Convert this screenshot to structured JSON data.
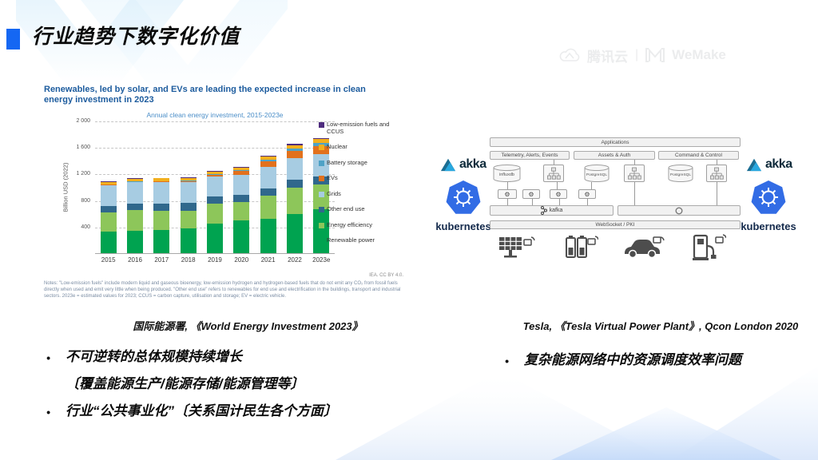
{
  "slide": {
    "title": "行业趋势下数字化价值"
  },
  "brand": {
    "tencent_cloud": "腾讯云",
    "divider": "|",
    "wemake": "WeMake"
  },
  "chart_panel": {
    "headline": "Renewables, led by solar, and EVs are leading the expected increase in clean energy investment in 2023",
    "source_note": "IEA. CC BY 4.0.",
    "notes": "Notes: \"Low-emission fuels\" include modern liquid and gaseous bioenergy, low-emission hydrogen and hydrogen-based fuels that do not emit any CO₂ from fossil fuels directly when used and emit very little when being produced. \"Other end use\" refers to renewables for end use and electrification in the buildings, transport and industrial sectors. 2023e = estimated values for 2023; CCUS = carbon capture, utilisation and storage; EV = electric vehicle.",
    "caption": "国际能源署, 《World Energy Investment 2023》"
  },
  "chart_data": {
    "type": "bar",
    "stacked": true,
    "title": "Annual clean energy investment, 2015-2023e",
    "xlabel": "",
    "ylabel": "Billion USD (2022)",
    "ylim": [
      0,
      2000
    ],
    "ytick_values": [
      400,
      800,
      1200,
      1600,
      2000
    ],
    "ytick_labels": [
      "400",
      "800",
      "1 200",
      "1 600",
      "2 000"
    ],
    "grid": true,
    "legend_position": "right",
    "categories": [
      "2015",
      "2016",
      "2017",
      "2018",
      "2019",
      "2020",
      "2021",
      "2022",
      "2023e"
    ],
    "series": [
      {
        "name": "Renewable power",
        "color": "#00A350",
        "values": [
          330,
          340,
          350,
          375,
          450,
          490,
          515,
          595,
          660
        ]
      },
      {
        "name": "Energy efficiency",
        "color": "#8DC65A",
        "values": [
          280,
          305,
          290,
          265,
          295,
          285,
          355,
          395,
          380
        ]
      },
      {
        "name": "Other end use",
        "color": "#30688C",
        "values": [
          100,
          105,
          105,
          115,
          110,
          105,
          105,
          115,
          120
        ]
      },
      {
        "name": "Grids",
        "color": "#A7CCE2",
        "values": [
          320,
          320,
          330,
          315,
          300,
          305,
          325,
          325,
          330
        ]
      },
      {
        "name": "EVs",
        "color": "#E2711D",
        "values": [
          5,
          8,
          12,
          18,
          32,
          55,
          85,
          115,
          130
        ]
      },
      {
        "name": "Battery storage",
        "color": "#4EA2C6",
        "values": [
          2,
          2,
          3,
          4,
          6,
          10,
          20,
          35,
          40
        ]
      },
      {
        "name": "Nuclear",
        "color": "#F2B01E",
        "values": [
          35,
          40,
          40,
          40,
          42,
          45,
          48,
          52,
          62
        ]
      },
      {
        "name": "Low-emission fuels and CCUS",
        "color": "#4F2D7F",
        "values": [
          8,
          8,
          8,
          8,
          10,
          10,
          12,
          14,
          18
        ]
      }
    ],
    "legend_top_to_bottom": [
      "Low-emission fuels and CCUS",
      "Nuclear",
      "Battery storage",
      "EVs",
      "Grids",
      "Other end use",
      "Energy efficiency",
      "Renewable power"
    ]
  },
  "diagram": {
    "applications": "Applications",
    "columns": [
      "Telemetry, Alerts, Events",
      "Assets & Auth",
      "Command & Control"
    ],
    "influxdb": "influxdb",
    "postgresql": "PostgreSQL",
    "kafka": "kafka",
    "websocket": "WebSocket / PKI",
    "akka": "akka",
    "kubernetes": "kubernetes",
    "devices": [
      "solar-panel",
      "battery-storage",
      "electric-car",
      "ev-charger"
    ],
    "caption": "Tesla, 《Tesla Virtual Power Plant》, Qcon London 2020"
  },
  "bullets": {
    "left": [
      {
        "text": "不可逆转的总体规模持续增长",
        "sub": "〔覆盖能源生产/能源存储/能源管理等〕"
      },
      {
        "text": "行业“公共事业化”〔关系国计民生各个方面〕"
      }
    ],
    "right": [
      {
        "text": "复杂能源网络中的资源调度效率问题"
      }
    ]
  },
  "colors": {
    "title_marker": "#1567F3",
    "chart_headline_blue": "#1D5C9E",
    "chart_subtitle_blue": "#4B8EC8",
    "kubernetes_blue": "#326CE5",
    "akka_navy": "#0E2A3A",
    "decoration_light_blue": "#D6EDFB",
    "decoration_bottom_blue": "#C7DCF9"
  }
}
